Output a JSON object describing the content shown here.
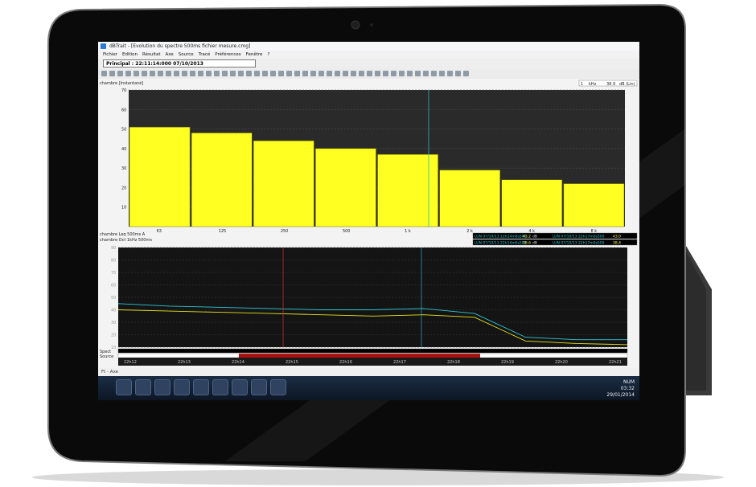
{
  "window": {
    "title": "dBTrait - [Evolution du spectre 500ms fichier mesure.cmg]"
  },
  "menubar": {
    "items": [
      "Fichier",
      "Edition",
      "Résultat",
      "Axe",
      "Source",
      "Tracé",
      "Préférences",
      "Fenêtre",
      "?"
    ]
  },
  "toolbar": {
    "position_label": "Principal : 22:11:14:000 07/10/2013"
  },
  "spectrum_panel": {
    "label": "chambre [Instantané]",
    "readout_freq": "1",
    "readout_freq_unit": "kHz",
    "readout_level": "38.9",
    "readout_level_unit": "dB (Lin)"
  },
  "time_panel": {
    "series_label_1": "chambre   Leq 500ms A",
    "series_label_2": "chambre   Oct 1kHz 500ms",
    "cursor_rows": [
      {
        "text_left": "LUN 07/10/13 22h14m6s500",
        "value_left": "43.2",
        "unit": "dB",
        "text_right": "LUN 07/10/13 22h17m0s500",
        "value_right": "43.0"
      },
      {
        "text_left": "LUN 07/10/13 22h14m6s500",
        "value_left": "38.6",
        "unit": "dB",
        "text_right": "LUN 07/10/13 22h17m0s500",
        "value_right": "38.4"
      }
    ],
    "row_labels": [
      "Spect",
      "Source"
    ],
    "axis_labels": [
      "Ft - Axe"
    ]
  },
  "taskbar": {
    "mode": "NUM",
    "time": "03:32",
    "date": "29/01/2014"
  },
  "chart_data": [
    {
      "type": "bar",
      "categories": [
        "63",
        "125",
        "250",
        "500",
        "1 k",
        "2 k",
        "4 k",
        "8 k"
      ],
      "values": [
        51,
        48,
        44,
        40,
        37,
        29,
        24,
        22
      ],
      "ylim": [
        0,
        70
      ],
      "yticks": [
        10,
        20,
        30,
        40,
        50,
        60,
        70
      ],
      "bar_color": "#ffff22",
      "grid": true
    },
    {
      "type": "line",
      "x_ticks": [
        "22h12",
        "22h13",
        "22h14",
        "22h15",
        "22h16",
        "22h17",
        "22h18",
        "22h19",
        "22h20",
        "22h21"
      ],
      "ylim": [
        10,
        90
      ],
      "yticks": [
        10,
        20,
        30,
        40,
        50,
        60,
        70,
        80,
        90
      ],
      "series": [
        {
          "color": "#2ec7d6",
          "values": [
            45,
            43,
            42,
            41,
            40,
            40,
            41,
            37,
            18,
            16,
            16
          ]
        },
        {
          "color": "#e5e21e",
          "values": [
            40,
            39,
            38,
            37,
            36,
            35,
            36,
            34,
            15,
            13,
            12
          ]
        }
      ],
      "grid": true
    }
  ]
}
